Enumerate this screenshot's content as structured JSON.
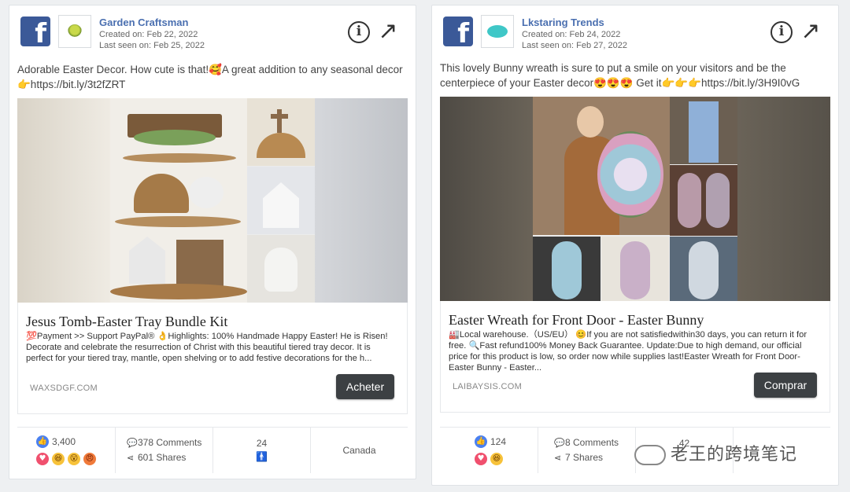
{
  "cards": [
    {
      "page_name": "Garden Craftsman",
      "created": "Created on: Feb 22, 2022",
      "last_seen": "Last seen on: Feb 25, 2022",
      "post_text": "Adorable Easter Decor. How cute is that!🥰A great addition to any seasonal decor 👉https://bit.ly/3t2fZRT",
      "link_title": "Jesus Tomb-Easter Tray Bundle Kit",
      "link_desc": "💯Payment >> Support PayPal® 👌Highlights: 100% Handmade Happy Easter! He is Risen! Decorate and celebrate the resurrection of Christ with this beautiful tiered tray decor.  It is perfect for your tiered tray, mantle, open shelving or to add festive decorations for the h...",
      "domain": "WAXSDGF.COM",
      "cta": "Acheter",
      "reactions_count": "3,400",
      "reactions": [
        "like",
        "love",
        "haha",
        "wow",
        "angry"
      ],
      "comments": "378 Comments",
      "shares": "601 Shares",
      "audience": "24",
      "country": "Canada"
    },
    {
      "page_name": "Lkstaring Trends",
      "created": "Created on: Feb 24, 2022",
      "last_seen": "Last seen on: Feb 27, 2022",
      "post_text": "This lovely Bunny wreath is sure to put a smile on your visitors and be the centerpiece of your Easter decor😍😍😍 Get it👉👉👉https://bit.ly/3H9I0vG",
      "link_title": "Easter Wreath for Front Door - Easter Bunny",
      "link_desc": "🏭Local warehouse.（US/EU） 😊If you are not satisfiedwithin30 days, you can return it for free. 🔍Fast refund100% Money Back Guarantee. Update:Due to high demand, our official price for this product is low, so order now while supplies last!Easter Wreath for Front Door- Easter Bunny - Easter...",
      "domain": "LAIBAYSIS.COM",
      "cta": "Comprar",
      "reactions_count": "124",
      "reactions": [
        "like",
        "love",
        "haha"
      ],
      "comments": "8 Comments",
      "shares": "7 Shares",
      "audience": "42"
    }
  ],
  "watermark": "老王的跨境笔记",
  "icons": {
    "facebook": "facebook-logo-icon",
    "info": "info-circle-icon",
    "share": "external-arrow-icon",
    "comment": "comment-bubble-icon",
    "shares": "share-nodes-icon",
    "person": "person-icon"
  },
  "colors": {
    "facebook_blue": "#3b5998",
    "page_name": "#4a6fb0",
    "cta_bg": "#3c4043"
  }
}
